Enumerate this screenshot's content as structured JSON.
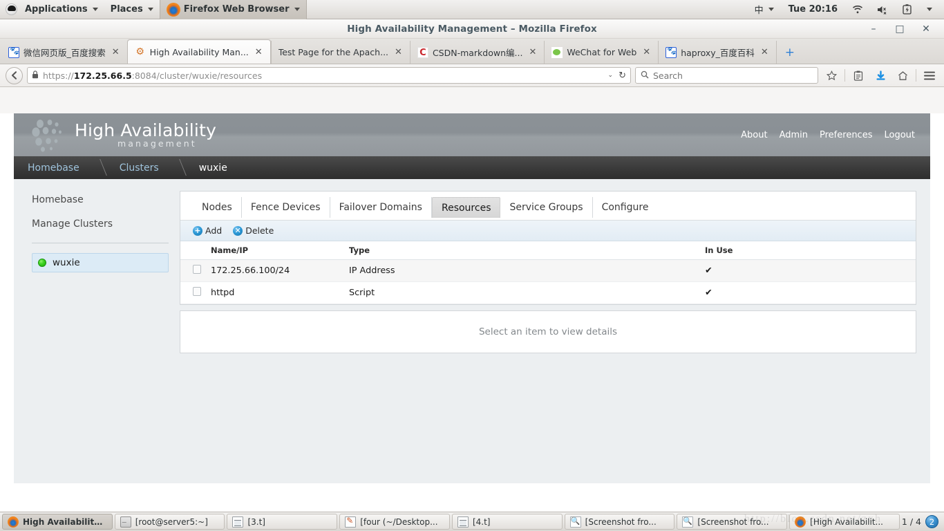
{
  "desktop": {
    "panel": {
      "applications": "Applications",
      "places": "Places",
      "active_window": "Firefox Web Browser",
      "input_method": "中",
      "clock": "Tue 20:16"
    }
  },
  "window": {
    "title": "High Availability Management – Mozilla Firefox",
    "buttons": {
      "minimize": "–",
      "maximize": "□",
      "close": "✕"
    }
  },
  "tabs": [
    {
      "label": "微信网页版_百度搜索",
      "icon": "baidu-favicon",
      "close": "✕",
      "selected": false
    },
    {
      "label": "High Availability Man...",
      "icon": "gear-favicon",
      "close": "✕",
      "selected": true
    },
    {
      "label": "Test Page for the Apach...",
      "icon": "none",
      "close": "✕",
      "selected": false
    },
    {
      "label": "CSDN-markdown编...",
      "icon": "csdn-favicon",
      "close": "✕",
      "selected": false
    },
    {
      "label": "WeChat for Web",
      "icon": "wechat-favicon",
      "close": "✕",
      "selected": false
    },
    {
      "label": "haproxy_百度百科",
      "icon": "baidu-favicon",
      "close": "✕",
      "selected": false
    }
  ],
  "newtab_label": "+",
  "navbar": {
    "back_icon": "←",
    "lock_icon": "🔒",
    "url_scheme": "https://",
    "url_host": "172.25.66.5",
    "url_rest": ":8084/cluster/wuxie/resources",
    "dropdown_icon": "⌄",
    "reload_icon": "↻",
    "search_placeholder": "Search",
    "search_value": "",
    "search_icon": "🔍",
    "bookmark_icon": "☆",
    "library_icon": "📑",
    "download_icon": "⬇",
    "home_icon": "⌂",
    "menu_icon": "☰"
  },
  "app": {
    "brand_title": "High Availability",
    "brand_subtitle": "management",
    "header_nav": [
      "About",
      "Admin",
      "Preferences",
      "Logout"
    ],
    "breadcrumb": [
      {
        "label": "Homebase",
        "current": false
      },
      {
        "label": "Clusters",
        "current": false
      },
      {
        "label": "wuxie",
        "current": true
      }
    ],
    "sidebar": {
      "links": [
        "Homebase",
        "Manage Clusters"
      ],
      "clusters": [
        {
          "name": "wuxie",
          "status": "running",
          "status_color": "#3fd424"
        }
      ]
    },
    "panel_tabs": [
      {
        "label": "Nodes",
        "active": false
      },
      {
        "label": "Fence Devices",
        "active": false
      },
      {
        "label": "Failover Domains",
        "active": false
      },
      {
        "label": "Resources",
        "active": true
      },
      {
        "label": "Service Groups",
        "active": false
      },
      {
        "label": "Configure",
        "active": false
      }
    ],
    "toolbar": {
      "add_label": "Add",
      "add_icon": "+",
      "delete_label": "Delete",
      "delete_icon": "✕"
    },
    "table": {
      "columns": [
        "Name/IP",
        "Type",
        "In Use"
      ],
      "rows": [
        {
          "name": "172.25.66.100/24",
          "type": "IP Address",
          "in_use": "✔",
          "checked": false
        },
        {
          "name": "httpd",
          "type": "Script",
          "in_use": "✔",
          "checked": false
        }
      ]
    },
    "detail_placeholder": "Select an item to view details"
  },
  "taskbar": {
    "items": [
      {
        "label": "High Availability ...",
        "icon": "firefox-icon",
        "active": true
      },
      {
        "label": "[root@server5:~]",
        "icon": "terminal-icon",
        "active": false
      },
      {
        "label": "[3.t]",
        "icon": "file-icon",
        "active": false
      },
      {
        "label": "[four (~/Desktop...",
        "icon": "editor-icon",
        "active": false
      },
      {
        "label": "[4.t]",
        "icon": "file-icon",
        "active": false
      },
      {
        "label": "[Screenshot fro...",
        "icon": "screenshot-icon",
        "active": false
      },
      {
        "label": "[Screenshot fro...",
        "icon": "screenshot-icon",
        "active": false
      },
      {
        "label": "[High Availabilit...",
        "icon": "firefox-icon",
        "active": false
      }
    ],
    "pager_text": "1 / 4",
    "pager_badge": "2"
  },
  "watermark": "http://blog.csdn.net/zxh"
}
